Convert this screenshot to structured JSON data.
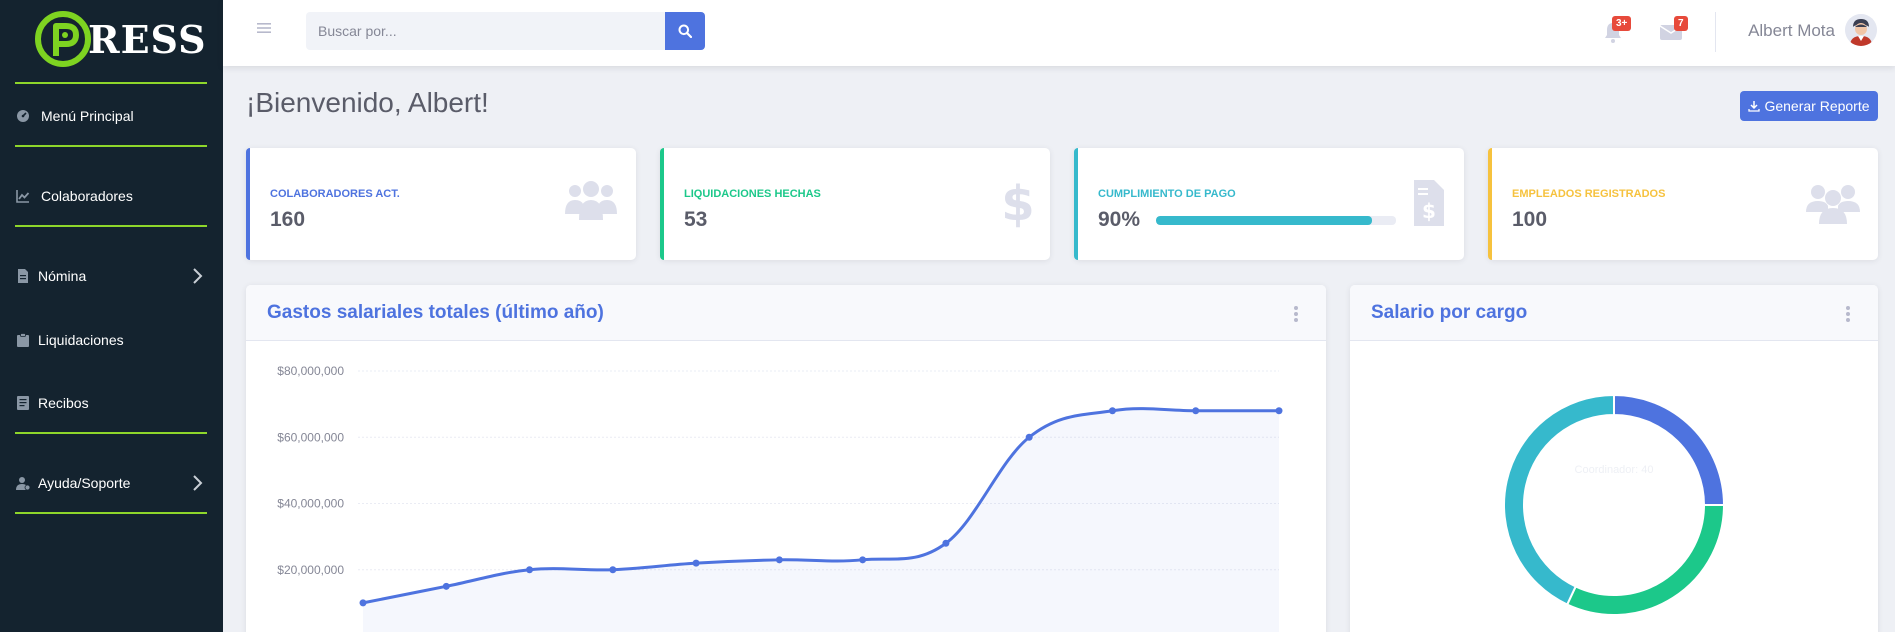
{
  "app": {
    "logo_text": "RESS"
  },
  "sidebar": {
    "items": [
      {
        "label": "Menú Principal",
        "icon": "dashboard-icon"
      },
      {
        "label": "Colaboradores",
        "icon": "chart-icon"
      },
      {
        "label": "Nómina",
        "icon": "document-icon",
        "expandable": true
      },
      {
        "label": "Liquidaciones",
        "icon": "clipboard-icon"
      },
      {
        "label": "Recibos",
        "icon": "receipt-icon"
      },
      {
        "label": "Ayuda/Soporte",
        "icon": "user-help-icon",
        "expandable": true
      }
    ]
  },
  "topbar": {
    "search_placeholder": "Buscar por...",
    "alerts_badge": "3+",
    "messages_badge": "7",
    "user_name": "Albert Mota"
  },
  "page": {
    "title": "¡Bienvenido, Albert!",
    "report_button": "Generar Reporte"
  },
  "cards": [
    {
      "label": "Colaboradores Act.",
      "value": "160",
      "color": "#4e73df",
      "icon": "people-group-icon"
    },
    {
      "label": "Liquidaciones Hechas",
      "value": "53",
      "color": "#1cc88a",
      "icon": "dollar-icon"
    },
    {
      "label": "Cumplimiento de pago",
      "value": "90%",
      "color": "#36b9cc",
      "icon": "invoice-dollar-icon",
      "progress": 0.9
    },
    {
      "label": "Empleados Registrados",
      "value": "100",
      "color": "#f6c23e",
      "icon": "users-icon"
    }
  ],
  "panels": {
    "area_title": "Gastos salariales totales (último año)",
    "pie_title": "Salario por cargo"
  },
  "chart_data": [
    {
      "type": "area",
      "title": "Gastos salariales totales (último año)",
      "x": [
        "1",
        "2",
        "3",
        "4",
        "5",
        "6",
        "7",
        "8",
        "9",
        "10",
        "11",
        "12"
      ],
      "y": [
        10000000,
        15000000,
        20000000,
        20000000,
        22000000,
        23000000,
        23000000,
        28000000,
        60000000,
        68000000,
        68000000,
        68000000
      ],
      "y_ticks": [
        "$20,000,000",
        "$40,000,000",
        "$60,000,000",
        "$80,000,000"
      ],
      "ylim": [
        0,
        80000000
      ],
      "grid": true,
      "color": "#4e73df"
    },
    {
      "type": "pie",
      "title": "Salario por cargo",
      "slices": [
        {
          "value": 25,
          "color": "#4e73df"
        },
        {
          "value": 32,
          "color": "#1cc88a"
        },
        {
          "value": 43,
          "color": "#36b9cc"
        }
      ],
      "tooltip": "Coordinador: 40"
    }
  ]
}
